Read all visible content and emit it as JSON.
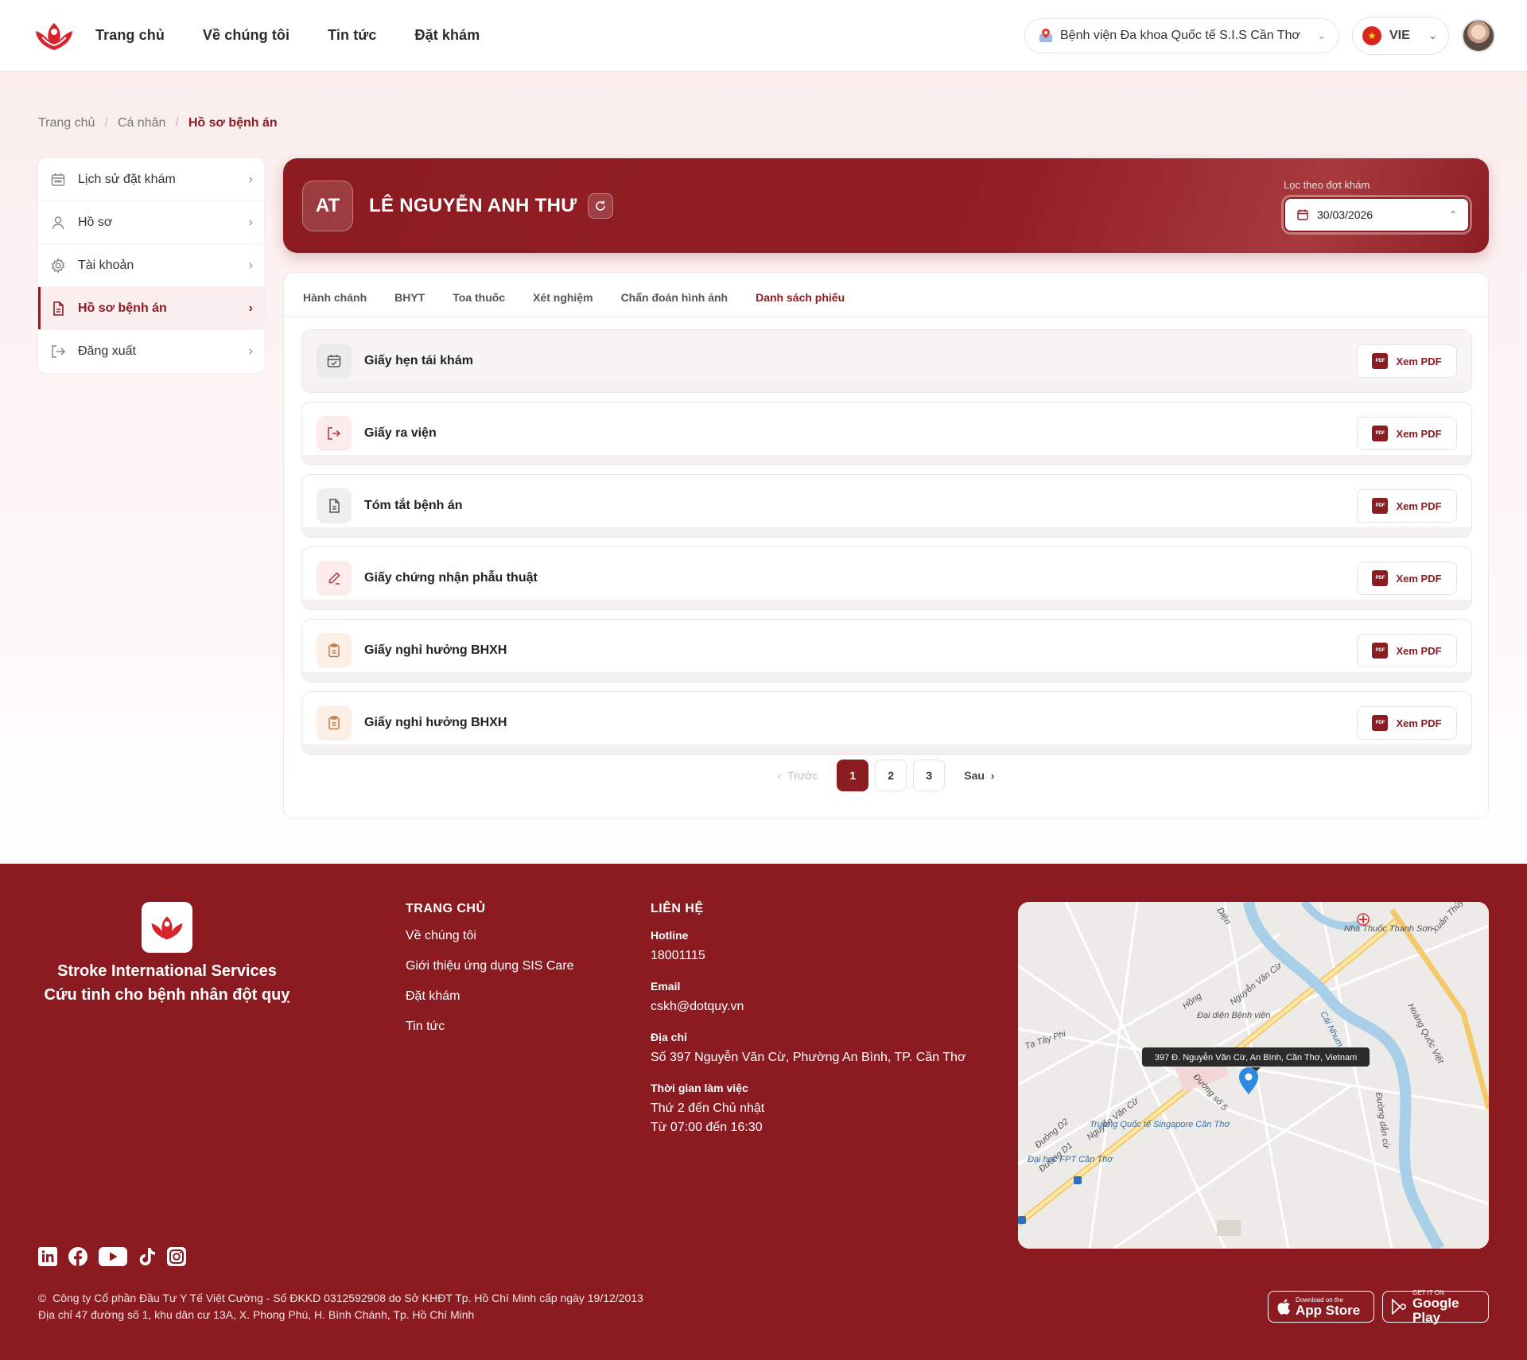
{
  "header": {
    "nav": [
      "Trang chủ",
      "Về chúng tôi",
      "Tin tức",
      "Đặt khám"
    ],
    "hospital": "Bệnh viện Đa khoa Quốc tế S.I.S Cần Thơ",
    "language": "VIE"
  },
  "breadcrumb": [
    "Trang chủ",
    "Cá nhân",
    "Hồ sơ bệnh án"
  ],
  "sidebar": {
    "items": [
      {
        "label": "Lịch sử đặt khám",
        "icon": "calendar-icon",
        "active": false
      },
      {
        "label": "Hồ sơ",
        "icon": "user-icon",
        "active": false
      },
      {
        "label": "Tài khoản",
        "icon": "gear-icon",
        "active": false
      },
      {
        "label": "Hồ sơ bệnh án",
        "icon": "document-icon",
        "active": true
      },
      {
        "label": "Đăng xuất",
        "icon": "logout-icon",
        "active": false
      }
    ]
  },
  "patient": {
    "initials": "AT",
    "name": "LÊ NGUYỄN ANH THƯ",
    "filter_label": "Lọc theo đợt khám",
    "filter_value": "30/03/2026"
  },
  "tabs": [
    "Hành chánh",
    "BHYT",
    "Toa thuốc",
    "Xét nghiệm",
    "Chẩn đoán hình ảnh",
    "Danh sách phiếu"
  ],
  "active_tab": "Danh sách phiếu",
  "documents": [
    {
      "title": "Giấy hẹn tái khám",
      "icon": "calendar-check-icon",
      "button": "Xem PDF"
    },
    {
      "title": "Giấy ra viện",
      "icon": "exit-icon",
      "button": "Xem PDF"
    },
    {
      "title": "Tóm tắt bệnh án",
      "icon": "file-text-icon",
      "button": "Xem PDF"
    },
    {
      "title": "Giấy chứng nhận phẫu thuật",
      "icon": "pen-icon",
      "button": "Xem PDF"
    },
    {
      "title": "Giấy nghỉ hưởng BHXH",
      "icon": "clipboard-icon",
      "button": "Xem PDF"
    },
    {
      "title": "Giấy nghỉ hưởng BHXH",
      "icon": "clipboard-icon",
      "button": "Xem PDF"
    }
  ],
  "pagination": {
    "prev": "Trước",
    "pages": [
      "1",
      "2",
      "3"
    ],
    "current": "1",
    "next": "Sau"
  },
  "footer": {
    "tagline_1": "Stroke International Services",
    "tagline_2": "Cứu tinh cho bệnh nhân đột quỵ",
    "col1_title": "TRANG CHỦ",
    "col1_links": [
      "Về chúng tôi",
      "Giới thiệu ứng dụng SIS Care",
      "Đặt khám",
      "Tin tức"
    ],
    "col2_title": "LIÊN HỆ",
    "hotline_label": "Hotline",
    "hotline": "18001115",
    "email_label": "Email",
    "email": "cskh@dotquy.vn",
    "address_label": "Địa chỉ",
    "address": "Số 397 Nguyễn Văn Cừ, Phường An Bình, TP. Cần Thơ",
    "hours_label": "Thời gian làm việc",
    "hours_1": "Thứ 2 đến Chủ nhật",
    "hours_2": "Từ 07:00 đến 16:30",
    "map_tooltip": "397 Đ. Nguyễn Văn Cừ, An Bình, Cần Thơ, Vietnam",
    "map_labels": [
      "Nguyễn Văn Cừ",
      "Nguyễn Văn Cừ",
      "Hoàng Quốc Việt",
      "Đường số 5",
      "Đường D1",
      "Đường D2",
      "Tạ Tây Phi",
      "Xuân Thủy",
      "Nhà Thuốc Thanh Sơn",
      "Trường Quốc tế Singapore Cần Thơ",
      "Đại học FPT Cần Thơ",
      "Đường dẫn cừ",
      "Diện",
      "Hồng",
      "Đại diện Bệnh viện",
      "Cái Nhum"
    ],
    "copyright_1": "Công ty Cổ phần Đầu Tư Y Tế Việt Cường - Số ĐKKD 0312592908 do Sở KHĐT Tp. Hồ Chí Minh cấp ngày 19/12/2013",
    "copyright_2": "Địa chỉ 47 đường số 1, khu dân cư 13A, X. Phong Phú, H. Bình Chánh, Tp. Hồ Chí Minh",
    "appstore_small": "Download on the",
    "appstore_big": "App Store",
    "play_small": "GET IT ON",
    "play_big": "Google Play"
  },
  "colors": {
    "brand": "#8c1c22",
    "bg_tint": "#fbeeed"
  }
}
